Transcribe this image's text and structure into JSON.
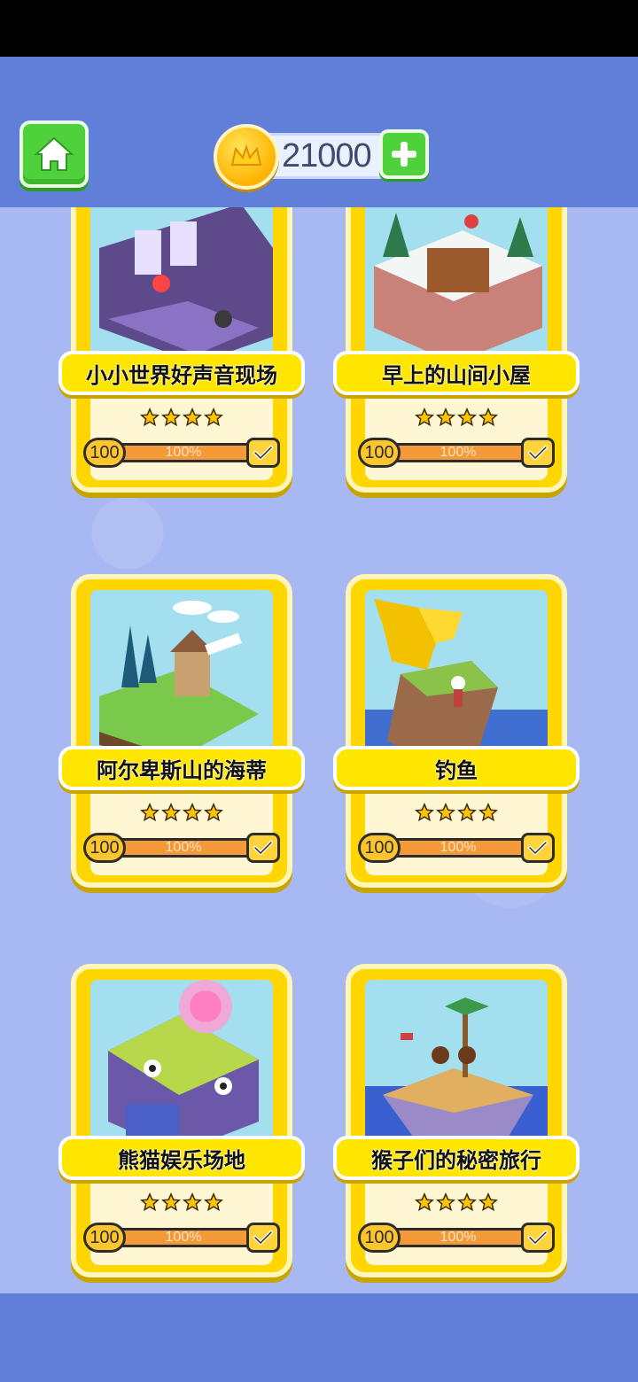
{
  "header": {
    "coins": "21000",
    "home_icon": "home-icon",
    "coin_icon": "crown-coin-icon",
    "add_icon": "plus-icon"
  },
  "colors": {
    "header_bg": "#5f7fd8",
    "content_bg": "#a8b8f2",
    "card_yellow": "#ffd600",
    "progress_orange": "#f08a2a",
    "button_green": "#4fd13c"
  },
  "levels": [
    {
      "title": "小小世界好声音现场",
      "stars": 4,
      "level": "100",
      "progress_text": "100%",
      "progress": 1.0,
      "completed": true
    },
    {
      "title": "早上的山间小屋",
      "stars": 4,
      "level": "100",
      "progress_text": "100%",
      "progress": 1.0,
      "completed": true
    },
    {
      "title": "阿尔卑斯山的海蒂",
      "stars": 4,
      "level": "100",
      "progress_text": "100%",
      "progress": 1.0,
      "completed": true
    },
    {
      "title": "钓鱼",
      "stars": 4,
      "level": "100",
      "progress_text": "100%",
      "progress": 1.0,
      "completed": true
    },
    {
      "title": "熊猫娱乐场地",
      "stars": 4,
      "level": "100",
      "progress_text": "100%",
      "progress": 1.0,
      "completed": true
    },
    {
      "title": "猴子们的秘密旅行",
      "stars": 4,
      "level": "100",
      "progress_text": "100%",
      "progress": 1.0,
      "completed": true
    }
  ]
}
